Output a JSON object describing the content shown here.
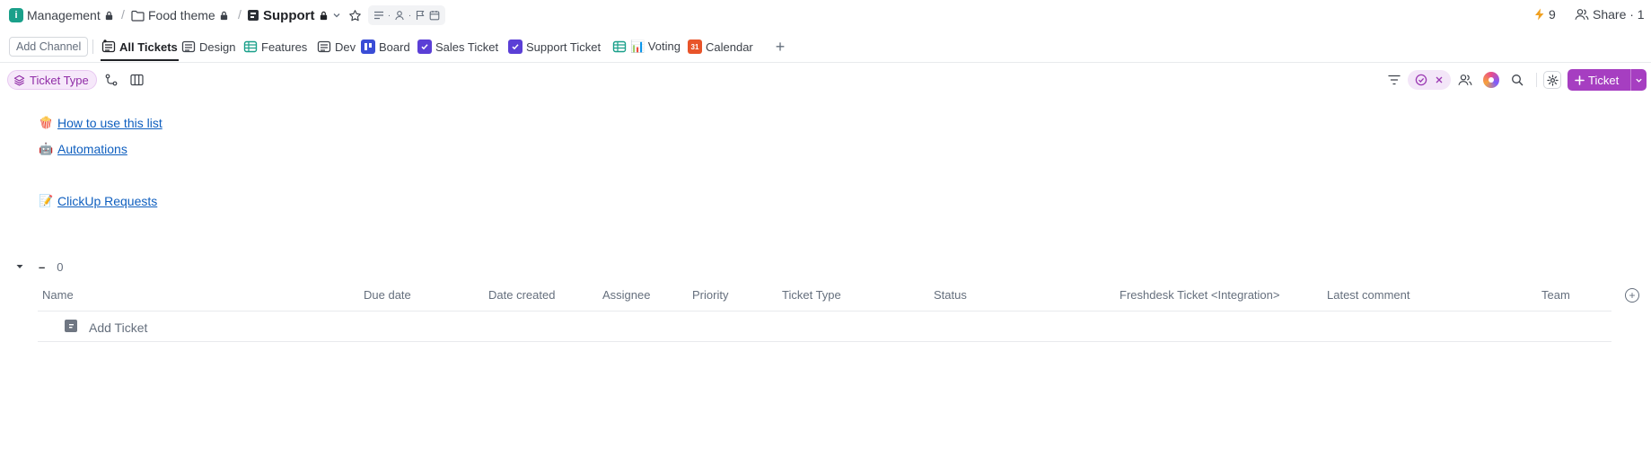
{
  "breadcrumb": {
    "space": {
      "label": "Management",
      "badge": "i"
    },
    "folder": {
      "label": "Food theme"
    },
    "list": {
      "label": "Support"
    }
  },
  "top_right": {
    "automations_count": "9",
    "share_label": "Share · 1"
  },
  "channels": {
    "add_channel_label": "Add Channel"
  },
  "tabs": [
    {
      "label": "All Tickets",
      "active": true
    },
    {
      "label": "Design"
    },
    {
      "label": "Features"
    },
    {
      "label": "Dev"
    },
    {
      "label": "Board"
    },
    {
      "label": "Sales Ticket"
    },
    {
      "label": "Support Ticket"
    },
    {
      "label": "📊 Voting"
    },
    {
      "label": "Calendar",
      "icon_text": "31"
    }
  ],
  "toolbar": {
    "group_by_chip": "Ticket Type",
    "add_button_label": "Ticket"
  },
  "description": {
    "links": [
      {
        "emoji": "🍿",
        "label": "How to use this list"
      },
      {
        "emoji": "🤖",
        "label": "Automations"
      },
      {
        "emoji": "📝",
        "label": "ClickUp Requests"
      }
    ]
  },
  "group": {
    "name": "–",
    "count": "0"
  },
  "table": {
    "columns": [
      "Name",
      "Due date",
      "Date created",
      "Assignee",
      "Priority",
      "Ticket Type",
      "Status",
      "Freshdesk Ticket <Integration>",
      "Latest comment",
      "Team"
    ],
    "add_row_label": "Add Ticket"
  },
  "colors": {
    "accent": "#a63ec1",
    "space_badge": "#1aa08a",
    "link": "#0f5fbf",
    "chip_bg": "#f6e8fa"
  }
}
